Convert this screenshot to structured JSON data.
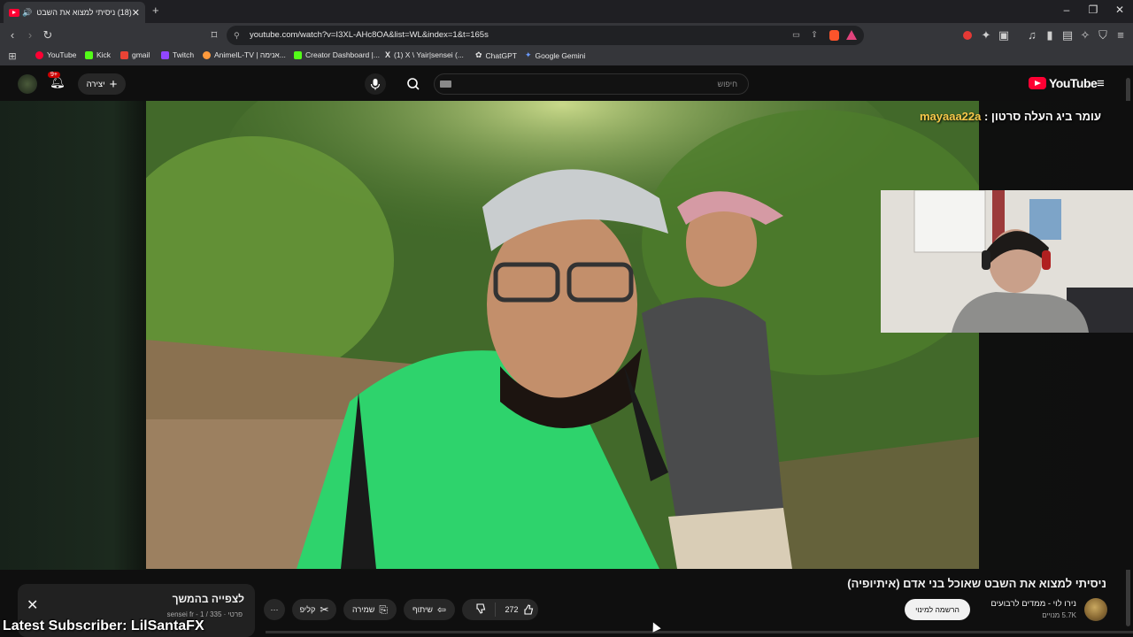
{
  "browser": {
    "tab_title": "(18) ניסיתי למצוא את השבט",
    "url": "youtube.com/watch?v=I3XL-AHc8OA&list=WL&index=1&t=165s",
    "bookmarks": [
      {
        "label": "YouTube",
        "color": "#ff0033"
      },
      {
        "label": "Kick",
        "color": "#53fc18"
      },
      {
        "label": "gmail",
        "color": "#ea4335"
      },
      {
        "label": "Twitch",
        "color": "#9146ff"
      },
      {
        "label": "AnimeIL-TV | אנימה...",
        "color": "#ff9a3c"
      },
      {
        "label": "Creator Dashboard |...",
        "color": "#53fc18"
      },
      {
        "label": "(1) X \\ Yair|sensei (...",
        "color": "#ffffff"
      },
      {
        "label": "ChatGPT",
        "color": "#d0d0d0"
      },
      {
        "label": "Google Gemini",
        "color": "#6b9bff"
      }
    ]
  },
  "youtube": {
    "logo_text": "YouTube",
    "search_placeholder": "חיפוש",
    "create_label": "יצירה",
    "notifications_count": "9+"
  },
  "video": {
    "overlay_text": "עומר ביג העלה סרטון : ",
    "overlay_user": "mayaaa22a",
    "title": "ניסיתי למצוא את השבט שאוכל בני אדם (איתיופיה)",
    "channel_name": "נירו לוי - ממדים לרבועים",
    "channel_subs": "5.7K מנויים",
    "subscribe_label": "הרשמה למינוי",
    "like_count": "272",
    "share_label": "שיתוף",
    "save_label": "שמירה",
    "clip_label": "קליפ",
    "more_label": "···"
  },
  "playlist": {
    "title": "לצפייה בהמשך",
    "meta": "פרטי · sensei fr - 1 / 335"
  },
  "stream_overlay": {
    "latest_subscriber": "Latest Subscriber: LilSantaFX"
  }
}
